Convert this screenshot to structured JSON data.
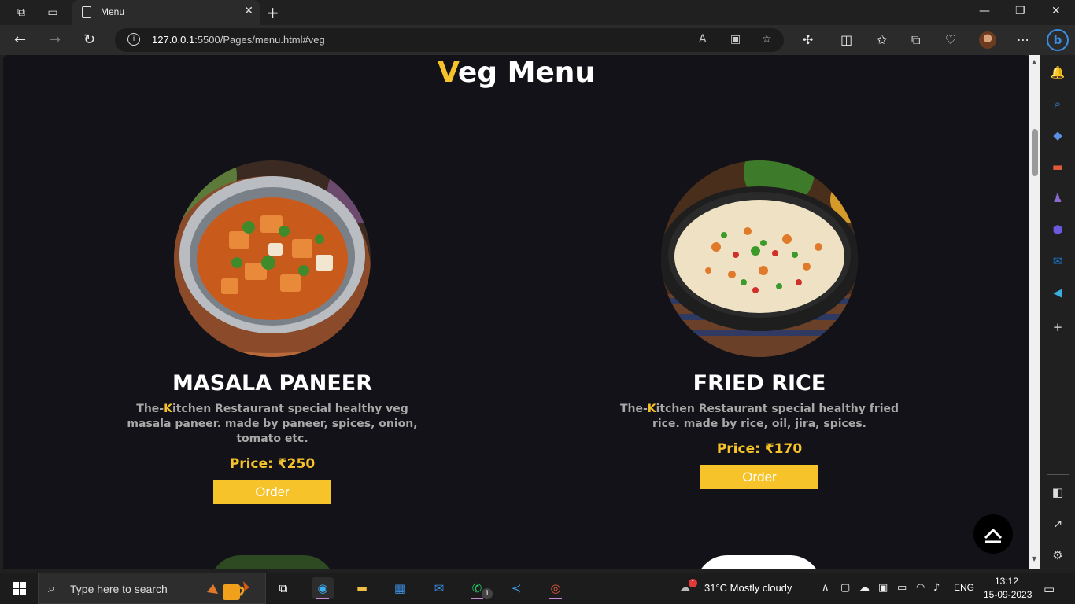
{
  "browser": {
    "tab_title": "Menu",
    "url_host": "127.0.0.1",
    "url_rest": ":5500/Pages/menu.html#veg"
  },
  "page": {
    "title_first_letter": "V",
    "title_rest": "eg Menu",
    "accent_color": "#f6c32a",
    "items": [
      {
        "name": "MASALA PANEER",
        "desc_prefix": "The-",
        "desc_k": "K",
        "desc_rest": "itchen Restaurant special healthy veg masala paneer. made by paneer, spices, onion, tomato etc.",
        "price": "Price: ₹250",
        "order_label": "Order"
      },
      {
        "name": "FRIED RICE",
        "desc_prefix": "The-",
        "desc_k": "K",
        "desc_rest": "itchen Restaurant special healthy fried rice. made by rice, oil, jira, spices.",
        "price": "Price: ₹170",
        "order_label": "Order"
      }
    ]
  },
  "taskbar": {
    "search_placeholder": "Type here to search",
    "weather": "31°C  Mostly cloudy",
    "language": "ENG",
    "time": "13:12",
    "date": "15-09-2023",
    "whatsapp_badge": "1",
    "weather_badge": "1"
  }
}
